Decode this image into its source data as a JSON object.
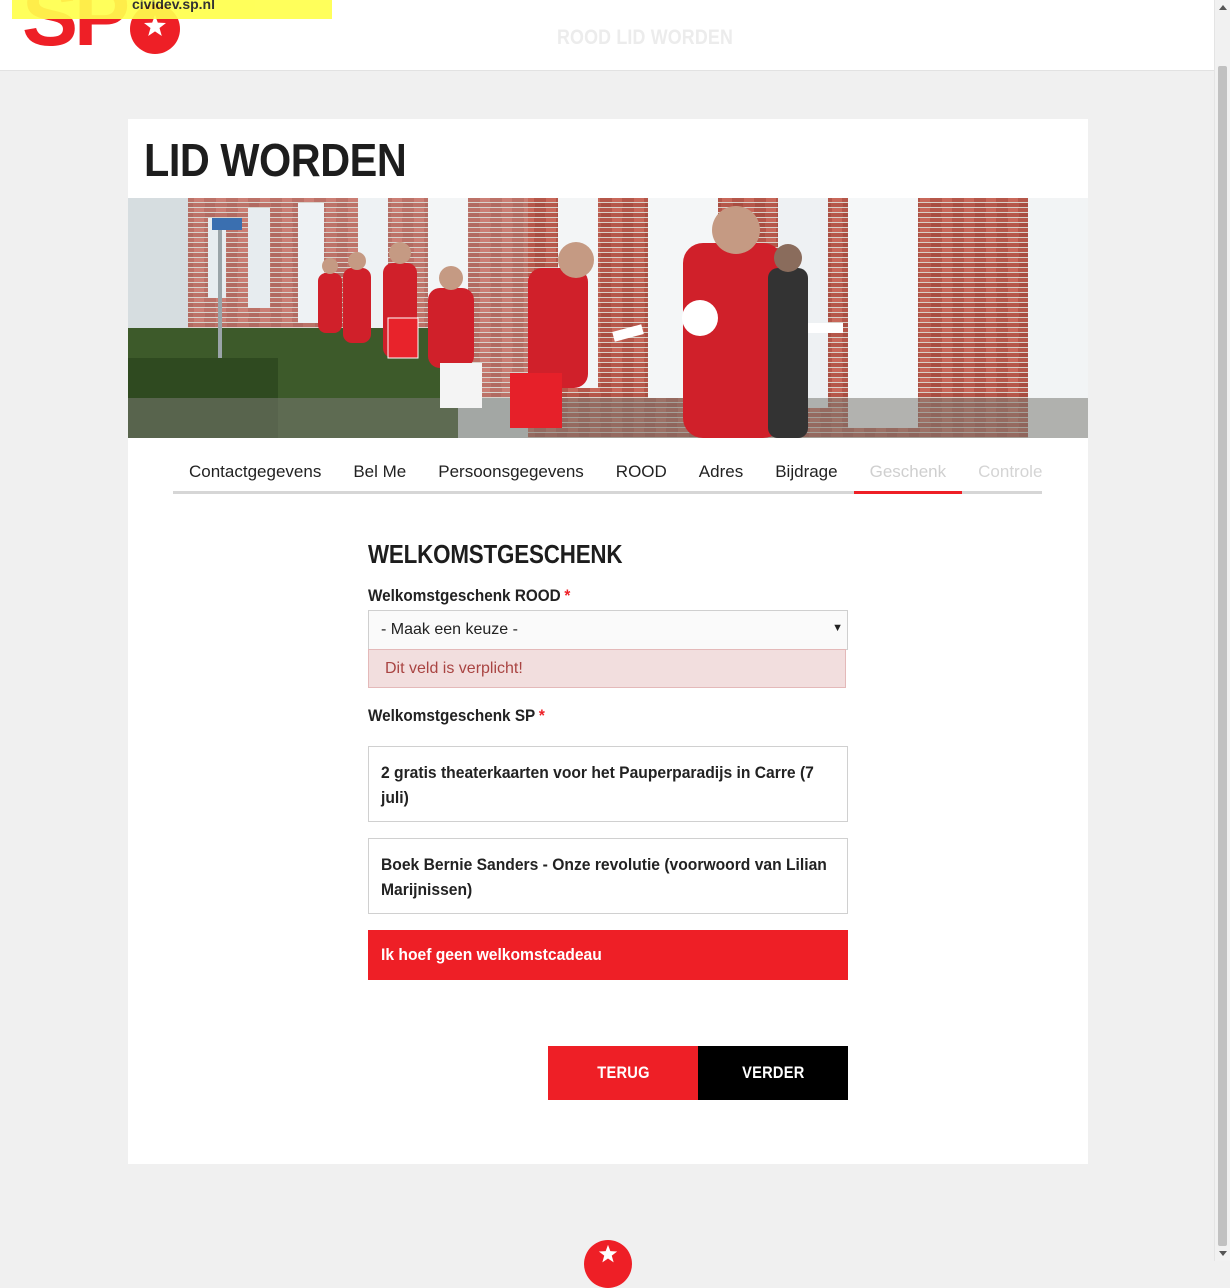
{
  "header": {
    "env_label": "cividev.sp.nl",
    "logo_text": "SP",
    "title": "ROOD LID WORDEN"
  },
  "page": {
    "title": "LID WORDEN"
  },
  "tabs": [
    {
      "label": "Contactgegevens",
      "state": "done"
    },
    {
      "label": "Bel Me",
      "state": "done"
    },
    {
      "label": "Persoonsgegevens",
      "state": "done"
    },
    {
      "label": "ROOD",
      "state": "done"
    },
    {
      "label": "Adres",
      "state": "done"
    },
    {
      "label": "Bijdrage",
      "state": "done"
    },
    {
      "label": "Geschenk",
      "state": "active"
    },
    {
      "label": "Controle",
      "state": "disabled"
    }
  ],
  "form": {
    "heading": "WELKOMSTGESCHENK",
    "rood": {
      "label": "Welkomstgeschenk ROOD",
      "required_mark": "*",
      "selected": "- Maak een keuze -",
      "error": "Dit veld is verplicht!"
    },
    "sp": {
      "label": "Welkomstgeschenk SP",
      "required_mark": "*",
      "options": [
        {
          "label": "2 gratis theaterkaarten voor het Pauperparadijs in Carre (7 juli)",
          "selected": false
        },
        {
          "label": "Boek Bernie Sanders - Onze revolutie (voorwoord van Lilian Marijnissen)",
          "selected": false
        },
        {
          "label": "Ik hoef geen welkomstcadeau",
          "selected": true
        }
      ]
    }
  },
  "buttons": {
    "back": "TERUG",
    "next": "VERDER"
  },
  "colors": {
    "brand_red": "#ee1f26",
    "error_bg": "#f2dede",
    "error_text": "#a94442",
    "page_bg": "#f0f0f0"
  },
  "icons": {
    "logo": "sp-tomato-logo",
    "footer": "sp-tomato-icon",
    "select_caret": "chevron-down-icon"
  }
}
